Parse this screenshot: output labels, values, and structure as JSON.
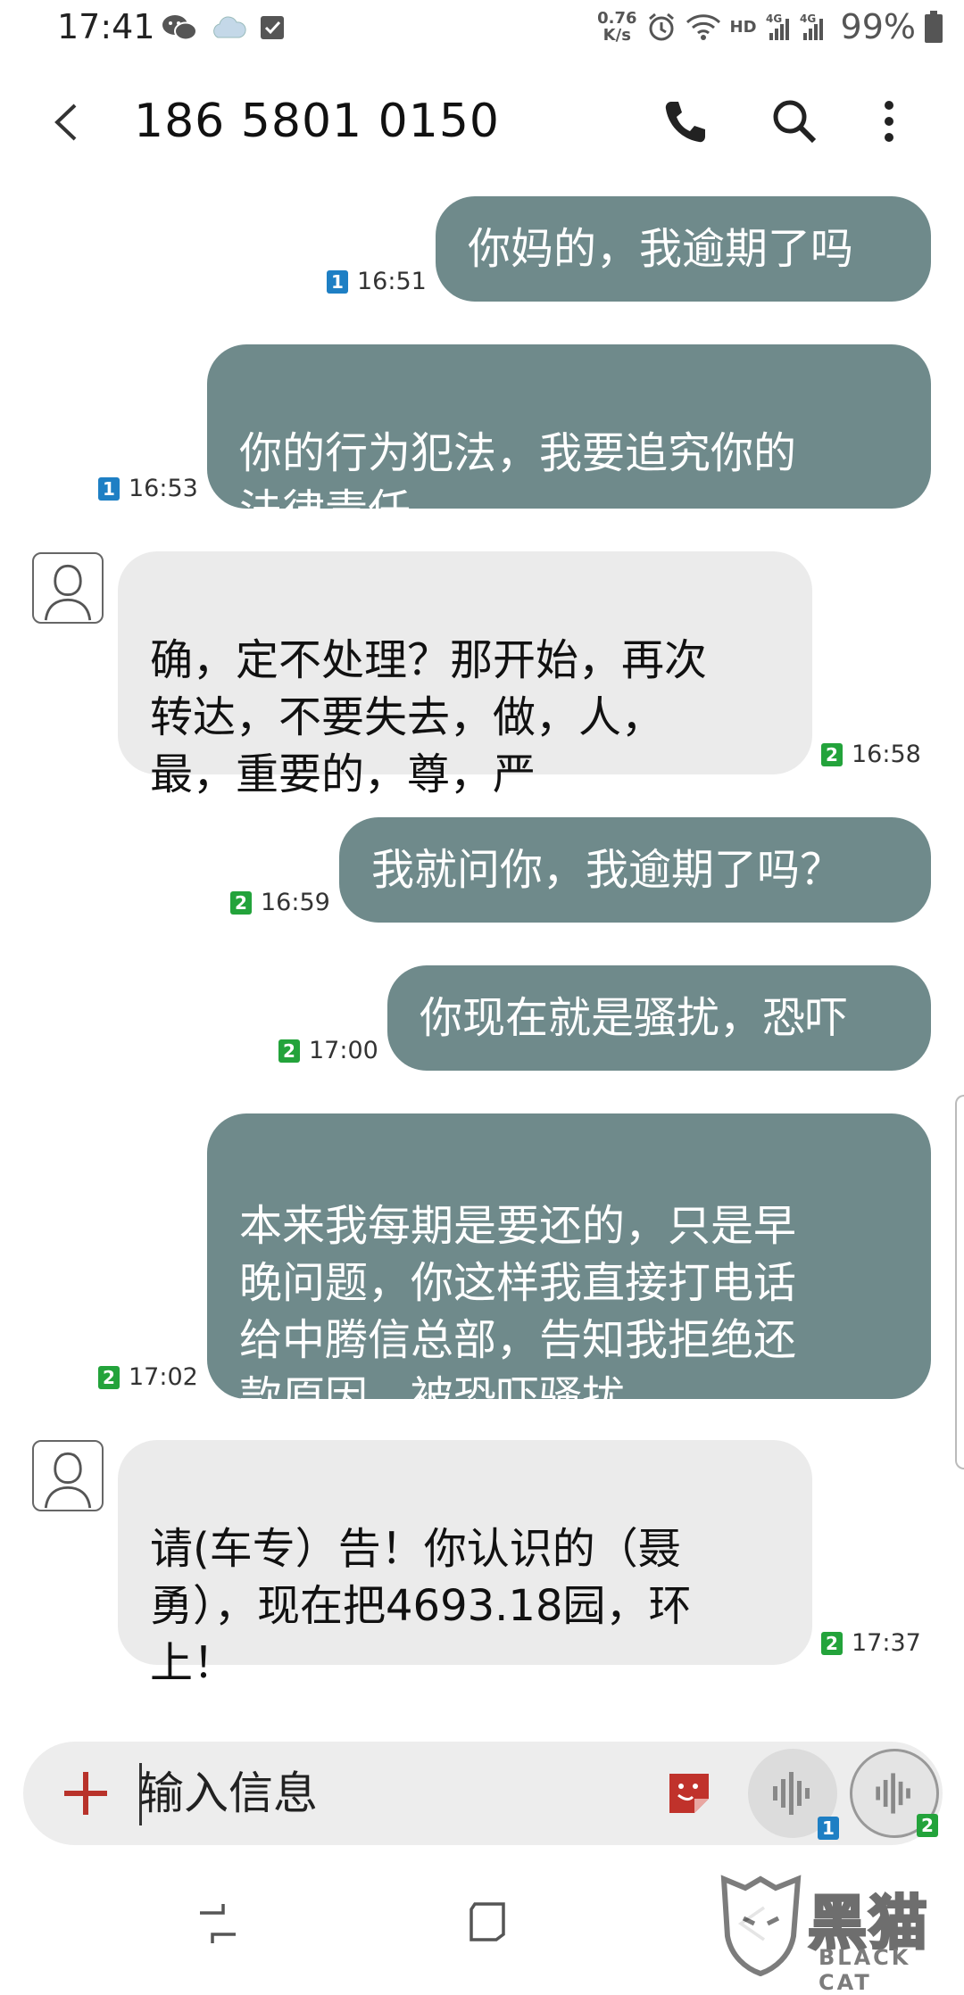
{
  "status_bar": {
    "time": "17:41",
    "net_speed_value": "0.76",
    "net_speed_unit": "K/s",
    "hd_label": "HD",
    "battery": "99%",
    "icons": [
      "wechat-icon",
      "cloud-icon",
      "check-box-icon",
      "alarm-icon",
      "wifi-icon",
      "signal-4g-icon",
      "battery-icon"
    ]
  },
  "header": {
    "contact_number": "186 5801 0150"
  },
  "messages": [
    {
      "direction": "out",
      "text": "你妈的，我逾期了吗",
      "sim": "1",
      "time": "16:51"
    },
    {
      "direction": "out",
      "text": "你的行为犯法，我要追究你的\n法律责任",
      "sim": "1",
      "time": "16:53"
    },
    {
      "direction": "in",
      "text": "确，定不处理？那开始，再次\n转达，不要失去，做，人，\n最，重要的，尊，严",
      "sim": "2",
      "time": "16:58"
    },
    {
      "direction": "out",
      "text": "我就问你，我逾期了吗？",
      "sim": "2",
      "time": "16:59"
    },
    {
      "direction": "out",
      "text": "你现在就是骚扰，恐吓",
      "sim": "2",
      "time": "17:00"
    },
    {
      "direction": "out",
      "text": "本来我每期是要还的，只是早\n晚问题，你这样我直接打电话\n给中腾信总部，告知我拒绝还\n款原因，被恐吓骚扰",
      "sim": "2",
      "time": "17:02"
    },
    {
      "direction": "in",
      "text": "请(车专）告！你认识的（聂\n勇），现在把4693.18园，环\n上！",
      "sim": "2",
      "time": "17:37"
    }
  ],
  "composer": {
    "placeholder": "输入信息",
    "voice_sim_1": "1",
    "voice_sim_2": "2"
  },
  "watermark": {
    "text": "黑猫",
    "sub": "BLACK CAT"
  },
  "colors": {
    "outgoing_bubble": "#6f8a8b",
    "incoming_bubble": "#ebebeb",
    "sim1": "#1e7fc4",
    "sim2": "#23a33b",
    "add_accent": "#b8322a",
    "sticker_accent": "#c0322b"
  }
}
